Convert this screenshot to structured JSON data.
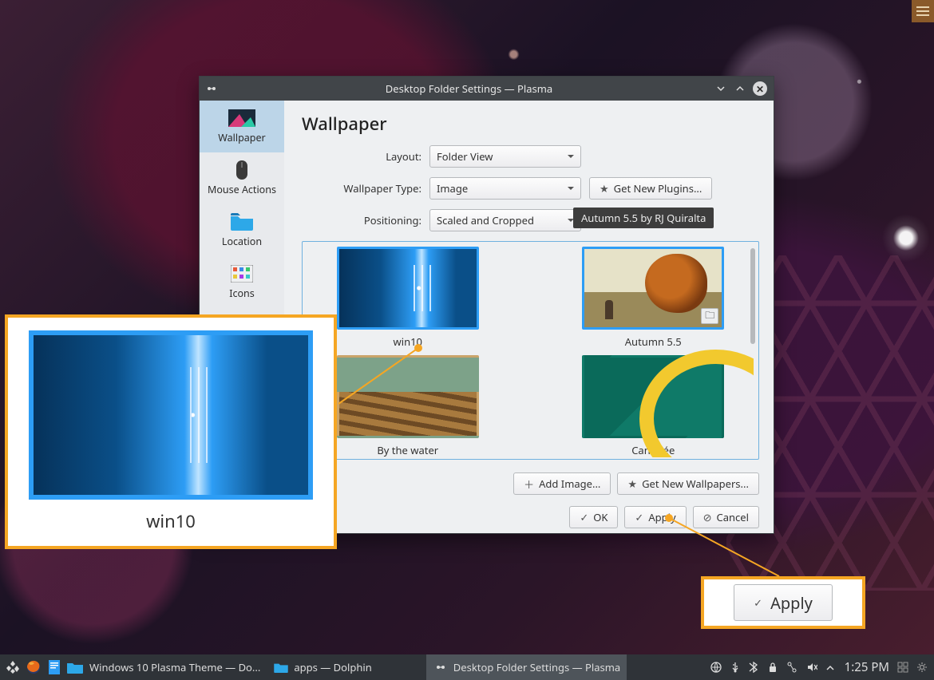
{
  "window": {
    "title": "Desktop Folder Settings — Plasma",
    "heading": "Wallpaper"
  },
  "sidebar": {
    "items": [
      {
        "label": "Wallpaper"
      },
      {
        "label": "Mouse Actions"
      },
      {
        "label": "Location"
      },
      {
        "label": "Icons"
      }
    ]
  },
  "form": {
    "layout_label": "Layout:",
    "layout_value": "Folder View",
    "type_label": "Wallpaper Type:",
    "type_value": "Image",
    "plugins_label": "Get New Plugins...",
    "positioning_label": "Positioning:",
    "positioning_value": "Scaled and Cropped"
  },
  "tooltip": "Autumn 5.5 by RJ Quiralta",
  "wallpapers": [
    {
      "name": "win10"
    },
    {
      "name": "Autumn 5.5"
    },
    {
      "name": "By the water"
    },
    {
      "name": "Canopée"
    }
  ],
  "buttons": {
    "add_image": "Add Image...",
    "get_wallpapers": "Get New Wallpapers...",
    "ok": "OK",
    "apply": "Apply",
    "cancel": "Cancel"
  },
  "callout": {
    "thumb_label": "win10",
    "apply_label": "Apply"
  },
  "taskbar": {
    "task1": "Windows 10 Plasma Theme — Do...",
    "task2": "apps — Dolphin",
    "task3": "Desktop Folder Settings — Plasma",
    "clock": "1:25 PM"
  }
}
